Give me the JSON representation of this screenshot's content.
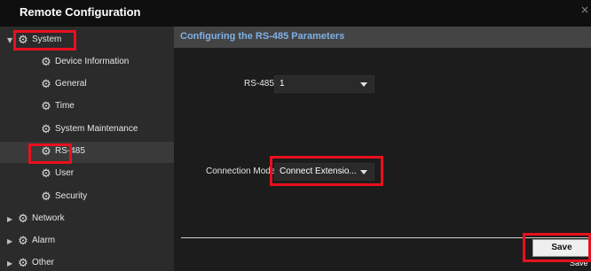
{
  "window": {
    "title": "Remote Configuration",
    "close_glyph": "×"
  },
  "sidebar": {
    "items": [
      {
        "label": "System",
        "icon": "gear-icon",
        "expandable": true,
        "expanded": true
      },
      {
        "label": "Device Information",
        "icon": "gear-icon"
      },
      {
        "label": "General",
        "icon": "gear-icon"
      },
      {
        "label": "Time",
        "icon": "gear-icon"
      },
      {
        "label": "System Maintenance",
        "icon": "gear-icon"
      },
      {
        "label": "RS-485",
        "icon": "gear-icon",
        "selected": true
      },
      {
        "label": "User",
        "icon": "gear-icon"
      },
      {
        "label": "Security",
        "icon": "gear-icon"
      },
      {
        "label": "Network",
        "icon": "gear-icon",
        "expandable": true,
        "expanded": false
      },
      {
        "label": "Alarm",
        "icon": "gear-icon",
        "expandable": true,
        "expanded": false
      },
      {
        "label": "Other",
        "icon": "gear-icon",
        "expandable": true,
        "expanded": false
      }
    ]
  },
  "main": {
    "section_title": "Configuring the RS-485 Parameters",
    "rs485": {
      "label": "RS-485:",
      "value": "1"
    },
    "connection_mode": {
      "label": "Connection Mode:",
      "value": "Connect Extensio..."
    },
    "save_label": "Save",
    "save_tooltip": "Save"
  },
  "colors": {
    "highlight": "#e8101e",
    "section_title": "#7eb0e6",
    "sidebar_bg": "#2b2b2b",
    "content_bg": "#1c1c1c",
    "titlebar_bg": "#0f0f0f"
  }
}
